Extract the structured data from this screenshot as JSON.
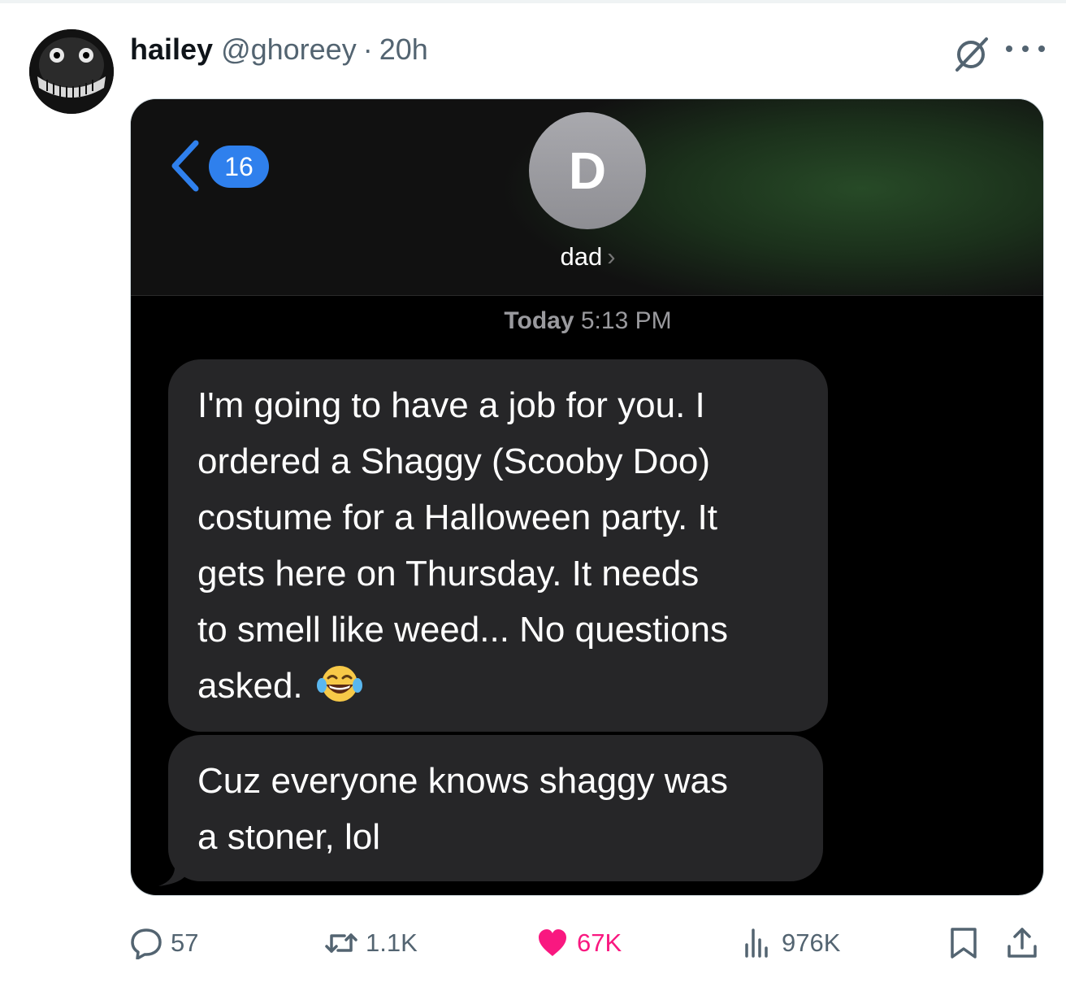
{
  "tweet": {
    "display_name": "hailey",
    "handle": "@ghoreey",
    "separator": "·",
    "time": "20h"
  },
  "screenshot": {
    "back_badge": "16",
    "contact_initial": "D",
    "contact_name": "dad",
    "contact_chevron": "›",
    "timestamp_day": "Today",
    "timestamp_time": "5:13 PM",
    "messages": [
      {
        "lines": [
          "I'm going to have a job for you.  I",
          "ordered a Shaggy (Scooby Doo)",
          "costume for a Halloween party.  It",
          "gets here on Thursday.  It needs",
          "to smell like weed... No questions",
          "asked."
        ],
        "emoji": "face-with-tears-of-joy"
      },
      {
        "lines": [
          "Cuz everyone knows shaggy was",
          "a stoner, lol"
        ]
      }
    ],
    "colors": {
      "bubble": "#262628",
      "badge": "#2f80ed",
      "header_glow": "#274a27"
    }
  },
  "actions": {
    "replies": "57",
    "reposts": "1.1K",
    "likes": "67K",
    "views": "976K"
  },
  "colors": {
    "like_active": "#f91880",
    "muted_text": "#536471"
  }
}
